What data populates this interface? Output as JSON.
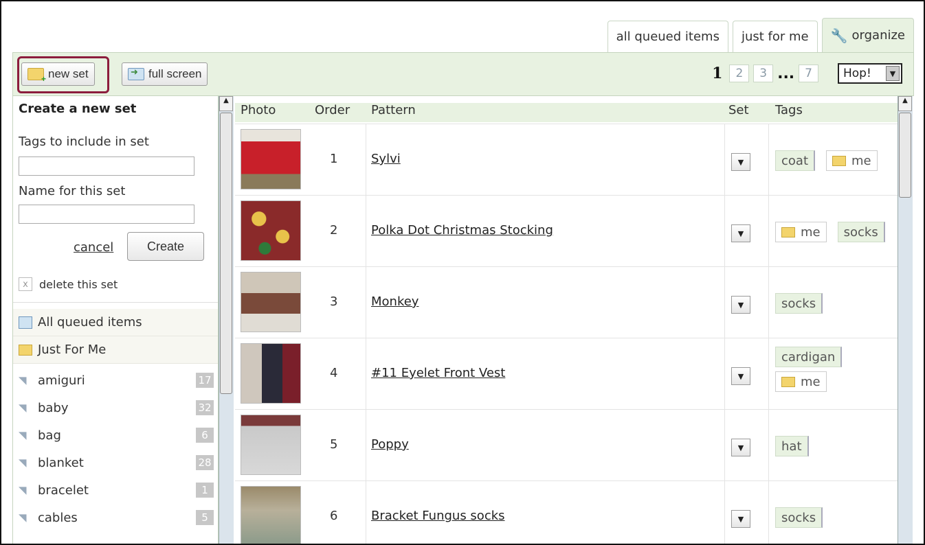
{
  "tabs": [
    {
      "label": "all queued items"
    },
    {
      "label": "just for me"
    },
    {
      "label": "organize",
      "icon": "wrench-icon",
      "active": true
    }
  ],
  "toolbar": {
    "new_set_label": "new set",
    "full_screen_label": "full screen",
    "pages": [
      "1",
      "2",
      "3",
      "7"
    ],
    "current_page": "1",
    "ellipsis": "...",
    "jump_value": "Hop!"
  },
  "sidebar": {
    "create_title": "Create a new set",
    "tags_label": "Tags to include in set",
    "tags_value": "",
    "name_label": "Name for this set",
    "name_value": "",
    "cancel_label": "cancel",
    "create_label": "Create",
    "delete_x": "x",
    "delete_label": "delete this set",
    "all_queued": "All queued items",
    "just_for_me": "Just For Me",
    "tag_items": [
      {
        "label": "amiguri",
        "count": "17"
      },
      {
        "label": "baby",
        "count": "32"
      },
      {
        "label": "bag",
        "count": "6"
      },
      {
        "label": "blanket",
        "count": "28"
      },
      {
        "label": "bracelet",
        "count": "1"
      },
      {
        "label": "cables",
        "count": "5"
      }
    ]
  },
  "table": {
    "headers": {
      "photo": "Photo",
      "order": "Order",
      "pattern": "Pattern",
      "set": "Set",
      "tags": "Tags"
    },
    "rows": [
      {
        "order": "1",
        "pattern": "Sylvi",
        "tags": [
          "coat",
          "me"
        ]
      },
      {
        "order": "2",
        "pattern": "Polka Dot Christmas Stocking",
        "tags": [
          "me",
          "socks"
        ]
      },
      {
        "order": "3",
        "pattern": "Monkey",
        "tags": [
          "socks"
        ]
      },
      {
        "order": "4",
        "pattern": "#11 Eyelet Front Vest",
        "tags": [
          "cardigan",
          "me"
        ]
      },
      {
        "order": "5",
        "pattern": "Poppy",
        "tags": [
          "hat"
        ]
      },
      {
        "order": "6",
        "pattern": "Bracket Fungus socks",
        "tags": [
          "socks"
        ]
      }
    ]
  },
  "colors": {
    "accent_green": "#e8f2e1",
    "highlight_border": "#8c1d3d",
    "tag_count_bg": "#c7c7c7"
  }
}
